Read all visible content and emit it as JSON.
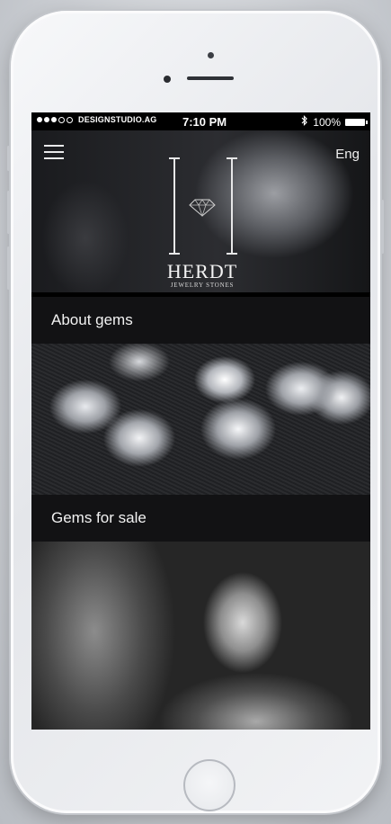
{
  "status_bar": {
    "carrier": "DESIGNSTUDIO.AG",
    "time": "7:10 PM",
    "battery": "100%"
  },
  "header": {
    "language": "Eng",
    "brand_name": "HERDT",
    "brand_tagline": "JEWELRY STONES"
  },
  "sections": [
    {
      "label": "About gems"
    },
    {
      "label": "Gems for sale"
    }
  ],
  "colors": {
    "screen_background": "#000000",
    "section_bar": "#141416",
    "text": "#f2f2f2"
  },
  "icons": {
    "menu": "hamburger-icon",
    "logo": "diamond-icon",
    "bluetooth": "bluetooth-icon",
    "battery": "battery-icon"
  }
}
